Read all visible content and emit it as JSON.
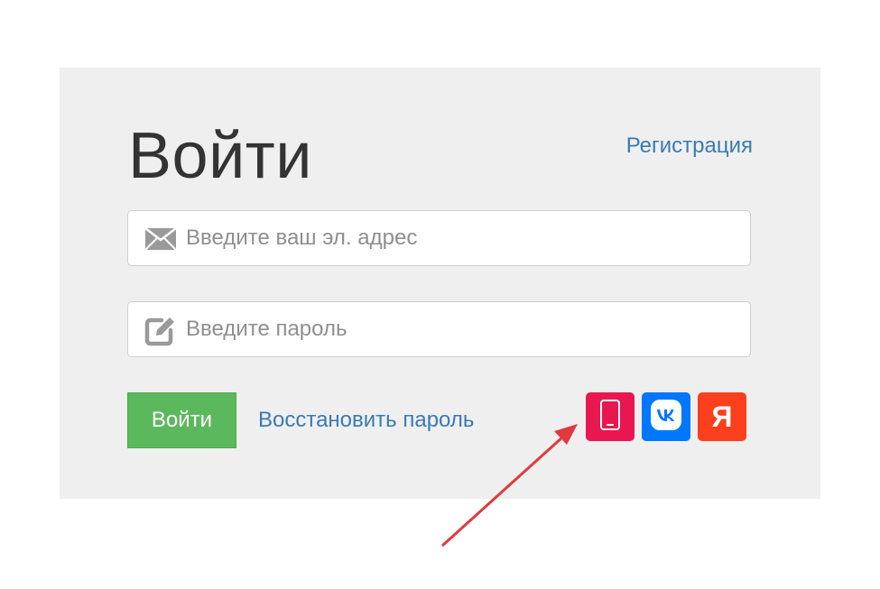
{
  "login": {
    "title": "Войти",
    "register_link": "Регистрация",
    "email": {
      "value": "",
      "placeholder": "Введите ваш эл. адрес",
      "icon": "envelope-icon"
    },
    "password": {
      "value": "",
      "placeholder": "Введите пароль",
      "icon": "pencil-square-icon"
    },
    "submit_label": "Войти",
    "recover_link": "Восстановить пароль",
    "social": [
      {
        "name": "phone",
        "icon": "phone-icon",
        "color": "#e8174f"
      },
      {
        "name": "vk",
        "icon": "vk-icon",
        "color": "#0077ff"
      },
      {
        "name": "yandex",
        "icon": "yandex-icon",
        "label": "Я",
        "color": "#fc3f1d"
      }
    ]
  },
  "colors": {
    "panel_bg": "#efefef",
    "link": "#3a7ab5",
    "button_green": "#5cb85c",
    "annotation_arrow": "#e0393e"
  }
}
